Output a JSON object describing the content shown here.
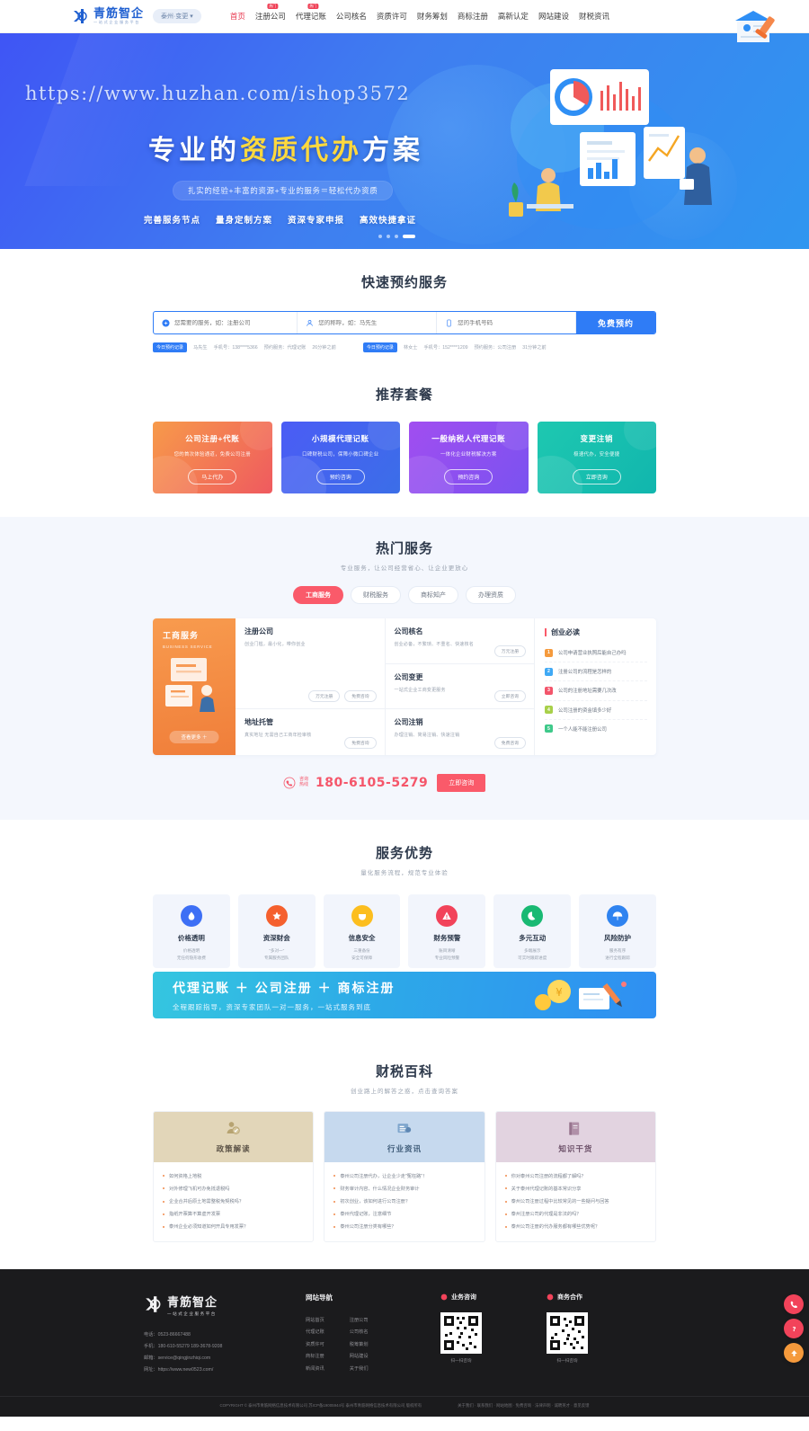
{
  "header": {
    "logo_main": "青筋智企",
    "logo_sub": "一站式企业服务平台",
    "city_selector": "泰州·变更 ▾",
    "nav": [
      {
        "label": "首页",
        "active": true,
        "badge": ""
      },
      {
        "label": "注册公司",
        "active": false,
        "badge": "热门"
      },
      {
        "label": "代理记账",
        "active": false,
        "badge": "热门"
      },
      {
        "label": "公司核名",
        "active": false,
        "badge": ""
      },
      {
        "label": "资质许可",
        "active": false,
        "badge": ""
      },
      {
        "label": "财务筹划",
        "active": false,
        "badge": ""
      },
      {
        "label": "商标注册",
        "active": false,
        "badge": ""
      },
      {
        "label": "高新认定",
        "active": false,
        "badge": ""
      },
      {
        "label": "网站建设",
        "active": false,
        "badge": ""
      },
      {
        "label": "财税资讯",
        "active": false,
        "badge": ""
      }
    ]
  },
  "hero": {
    "watermark_url": "https://www.huzhan.com/ishop3572",
    "title_pre": "专业的",
    "title_hl": "资质代办",
    "title_post": "方案",
    "subtitle": "扎实的经验+丰富的资源+专业的服务＝轻松代办资质",
    "features": [
      "完善服务节点",
      "量身定制方案",
      "资深专家申报",
      "高效快捷拿证"
    ],
    "slide_count": 4,
    "active_slide": 4
  },
  "booking": {
    "title": "快速预约服务",
    "service_placeholder": "您需要的服务，如：注册公司",
    "name_placeholder": "您的称呼，如：马先生",
    "phone_placeholder": "您的手机号码",
    "submit_label": "免费预约",
    "tickers": [
      {
        "tag": "今日预约记录",
        "name": "马先生",
        "phone_label": "手机号：",
        "phone": "138****5366",
        "service_label": "预约服务：",
        "service": "代理记账",
        "time": "26分钟之前"
      },
      {
        "tag": "今日预约记录",
        "name": "林女士",
        "phone_label": "手机号：",
        "phone": "152****1209",
        "service_label": "预约服务：",
        "service": "公司注册",
        "time": "31分钟之前"
      }
    ]
  },
  "packages": {
    "title": "推荐套餐",
    "items": [
      {
        "title": "公司注册+代账",
        "desc": "您的首次体验通道，免费公司注册",
        "button": "马上代办",
        "c1": "#f79a4a",
        "c2": "#ef5a5f"
      },
      {
        "title": "小规模代理记账",
        "desc": "口碑财税公司，保障小微口碑企业",
        "button": "预约咨询",
        "c1": "#4b5cf5",
        "c2": "#3b6ee8"
      },
      {
        "title": "一般纳税人代理记账",
        "desc": "一体化企业财税解决方案",
        "button": "预约咨询",
        "c1": "#a14ef0",
        "c2": "#7a52f0"
      },
      {
        "title": "变更注销",
        "desc": "极速代办，安全便捷",
        "button": "立即咨询",
        "c1": "#1ec8b0",
        "c2": "#11b6ae"
      }
    ]
  },
  "hot_services": {
    "title": "热门服务",
    "subtitle": "专业服务，让公司经营省心、让企业更放心",
    "tabs": [
      {
        "label": "工商服务",
        "active": true
      },
      {
        "label": "财税服务",
        "active": false
      },
      {
        "label": "商标知产",
        "active": false
      },
      {
        "label": "办理资质",
        "active": false
      }
    ],
    "promo": {
      "title": "工商服务",
      "sub": "BUSINESS SERVICE",
      "button": "查看更多 ＋"
    },
    "items": [
      {
        "title": "注册公司",
        "desc": "创业门槛，最小化，带你创业",
        "buttons": [
          "万元注册",
          "免费咨询"
        ]
      },
      {
        "title": "地址托管",
        "desc": "真实地址 无需自己工商年检审核",
        "buttons": [
          "免费咨询"
        ]
      },
      {
        "title": "公司核名",
        "desc": "创业必备，不繁琐、不重名、快速核名",
        "buttons": [
          "万元注册"
        ]
      },
      {
        "title": "公司变更",
        "desc": "一站式企业工商变更服务",
        "buttons": [
          "立即咨询"
        ]
      },
      {
        "title": "公司注销",
        "desc": "办理注销、简易注销、快速注销",
        "buttons": [
          "免费咨询"
        ]
      }
    ],
    "must_read_title": "创业必读",
    "must_read": [
      {
        "n": "1",
        "text": "公司申请营业执照后能自己办吗",
        "color": "#f59a3c"
      },
      {
        "n": "2",
        "text": "注册公司的流程是怎样的",
        "color": "#3fa9f5"
      },
      {
        "n": "3",
        "text": "公司的注册地址需要几次改",
        "color": "#f3556b"
      },
      {
        "n": "4",
        "text": "公司注册的资金填多少好",
        "color": "#a8d04a"
      },
      {
        "n": "5",
        "text": "一个人能不能注册公司",
        "color": "#3fc98a"
      }
    ],
    "phone_label_line1": "咨询",
    "phone_label_line2": "热线",
    "phone_number": "180-6105-5279",
    "phone_button": "立即咨询"
  },
  "advantages": {
    "title": "服务优势",
    "subtitle": "量化服务流程，规范专业体验",
    "items": [
      {
        "title": "价格透明",
        "d1": "价格透明",
        "d2": "无任何隐形收费",
        "color": "#3d6ff5",
        "icon": "drop-icon"
      },
      {
        "title": "资深财会",
        "d1": "\"多对一\"",
        "d2": "专属服务团队",
        "color": "#f5602e",
        "icon": "star-icon"
      },
      {
        "title": "信息安全",
        "d1": "三重备份",
        "d2": "安全可保障",
        "color": "#fcbe1f",
        "icon": "shield-icon"
      },
      {
        "title": "财务预警",
        "d1": "账目清晰",
        "d2": "专业风险预警",
        "color": "#f2435a",
        "icon": "alert-icon"
      },
      {
        "title": "多元互动",
        "d1": "多端展示",
        "d2": "可实时跟踪进度",
        "color": "#19b973",
        "icon": "chat-icon"
      },
      {
        "title": "风险防护",
        "d1": "服务有序",
        "d2": "进行全程跟踪",
        "color": "#2f83f0",
        "icon": "umbrella-icon"
      }
    ]
  },
  "cta_banner": {
    "title": "代理记账 ＋ 公司注册 ＋ 商标注册",
    "subtitle": "全程跟踪指导，资深专家团队一对一服务，一站式服务到底"
  },
  "baike": {
    "title": "财税百科",
    "subtitle": "创业路上的解答之惑，点击查询答案",
    "cards": [
      {
        "title": "政策解读",
        "icon": "policy-icon",
        "bg": "#e2d6b9",
        "fg": "#5c5347",
        "items": [
          "如何资格上地税",
          "对外修理飞机可办免抵退税吗",
          "企业合并后原土地需整税免契税吗？",
          "指纸开票算不算虚开发票",
          "泰州企业必须知道如何开具专用发票？"
        ]
      },
      {
        "title": "行业资讯",
        "icon": "news-icon",
        "bg": "#c6d9ee",
        "fg": "#3d5a77",
        "items": [
          "泰州公司注册代办，让企业少走\"冤枉路\"！",
          "财务审计内容、什么情况企业财务审计",
          "初次创业，该如何进行公司注册？",
          "泰州代理记账，注意细节",
          "泰州公司注册分类有哪些？"
        ]
      },
      {
        "title": "知识干货",
        "icon": "book-icon",
        "bg": "#e2d3e0",
        "fg": "#6b4f67",
        "items": [
          "你对泰州公司注册的流程都了解吗？",
          "关于泰州代理记账的基本常识分享",
          "泰州公司注册过程中比较常见的一些疑问与回答",
          "泰州注册公司的代理是非法的吗？",
          "泰州公司注册的代办服务都有哪些优势呢？"
        ]
      }
    ]
  },
  "footer": {
    "logo_main": "青筋智企",
    "logo_sub": "一站式企业服务平台",
    "contact": [
      "电话：0523-86667488",
      "手机：180-610-55279 189-3678-9208",
      "邮箱：service@qingjinzhiqi.com",
      "网址：https://www.new0523.com/"
    ],
    "nav_title": "网站导航",
    "nav_col1": [
      "网站首页",
      "代理记账",
      "资质许可",
      "商标注册",
      "新闻资讯"
    ],
    "nav_col2": [
      "注册公司",
      "公司核名",
      "税筹策划",
      "网站建设",
      "关于我们"
    ],
    "qr1_title": "业务咨询",
    "qr1_caption": "扫一扫咨询",
    "qr2_title": "商务合作",
    "qr2_caption": "扫一扫咨询",
    "copyright": "COPYRIGHT © 泰州市青筋网络信息技术有限公司  苏ICP备19005944号   泰州市青筋网络信息技术有限公司  版权所有",
    "links": "关于我们 · 联系我们 · 网站地图 · 免费咨询 · 法律声明 · 诚聘英才 · 意见反馈"
  },
  "side_rail": [
    {
      "icon": "phone-icon",
      "color": "#f2435a"
    },
    {
      "icon": "qa-icon",
      "color": "#f2435a"
    },
    {
      "icon": "arrow-up-icon",
      "color": "#f59a3c"
    }
  ]
}
